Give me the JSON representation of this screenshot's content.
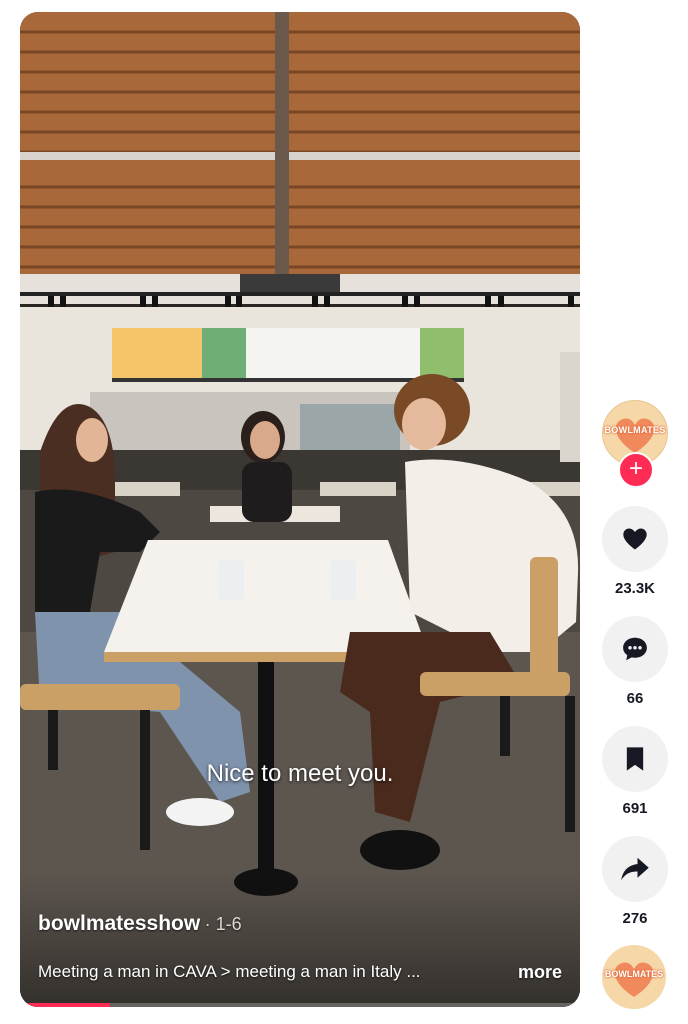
{
  "video": {
    "subtitle": "Nice to meet you.",
    "author": "bowlmatesshow",
    "date": "1-6",
    "description": "Meeting a man in CAVA > meeting a man in Italy ...",
    "more_label": "more",
    "progress_fraction": 0.16
  },
  "creator": {
    "avatar_text": "BOWLMATES",
    "follow_label": "+"
  },
  "actions": {
    "like_count": "23.3K",
    "comment_count": "66",
    "save_count": "691",
    "share_count": "276"
  },
  "sound": {
    "disc_text": "BOWLMATES"
  },
  "colors": {
    "accent": "#fe2c55",
    "button_bg": "#f1f1f2",
    "count_text": "#161823"
  }
}
